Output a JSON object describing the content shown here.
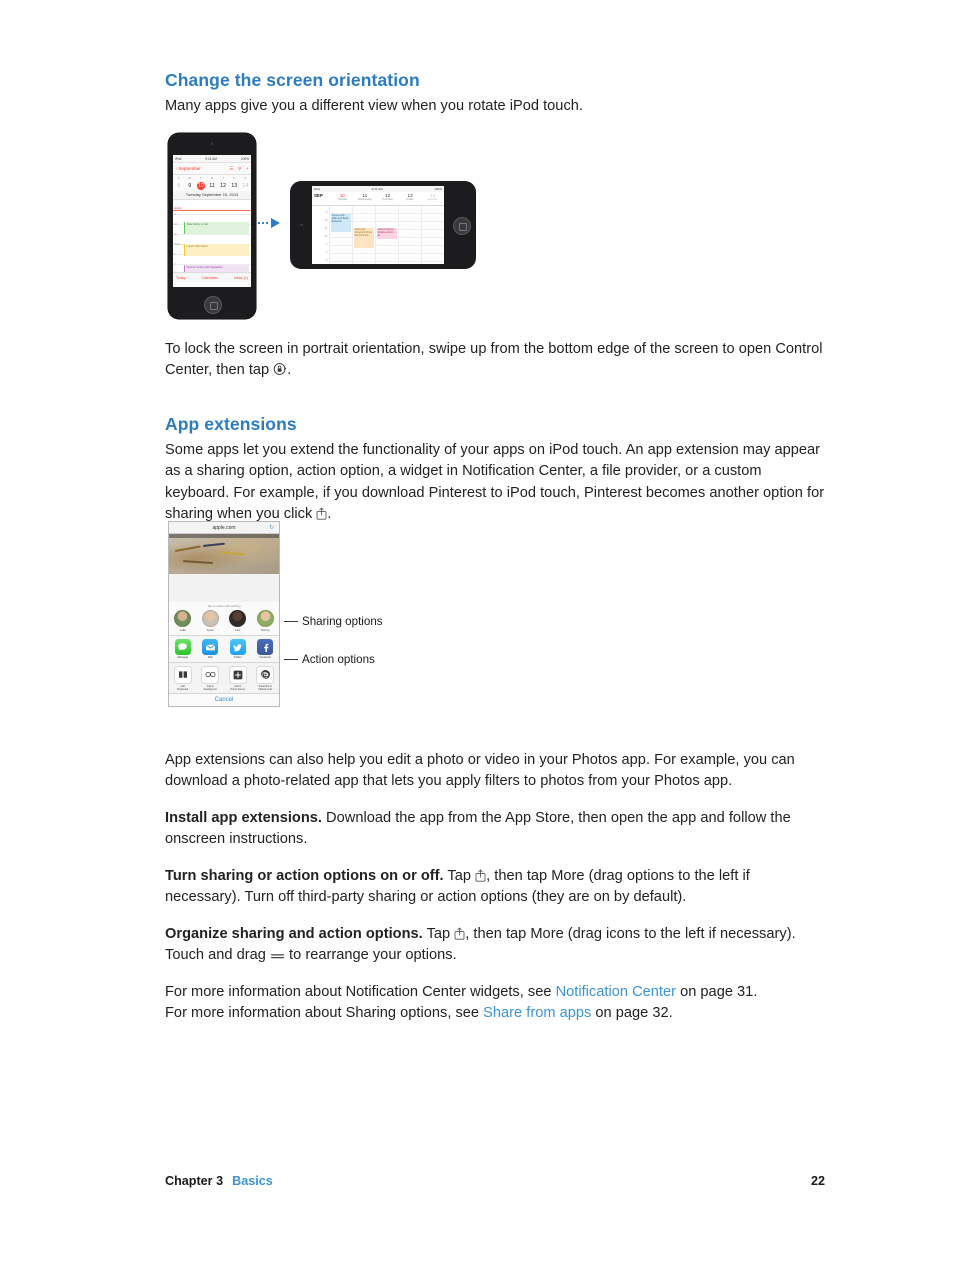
{
  "document": {
    "sections": [
      {
        "id": "change-orientation",
        "heading": "Change the screen orientation",
        "intro": "Many apps give you a different view when you rotate iPod touch.",
        "after_figure_line1": "To lock the screen in portrait orientation, swipe up from the bottom edge of the screen to open",
        "after_figure_line2_prefix": "Control Center, then tap ",
        "after_figure_line2_suffix": "."
      },
      {
        "id": "app-extensions",
        "heading": "App extensions",
        "paragraph1_part1": "Some apps let you extend the functionality of your apps on iPod touch. An app extension may appear as a sharing option, action option, a widget in Notification Center, a file provider, or a custom keyboard. For example, if you download Pinterest to iPod touch, Pinterest becomes another option for sharing when you click ",
        "paragraph1_part2": ".",
        "paragraph2": "App extensions can also help you edit a photo or video in your Photos app. For example, you can download a photo-related app that lets you apply filters to photos from your Photos app.",
        "install_bold": "Install app extensions.",
        "install_rest": " Download the app from the App Store, then open the app and follow the onscreen instructions.",
        "turn_bold": "Turn sharing or action options on or off.",
        "turn_rest_a": " Tap ",
        "turn_rest_b": ", then tap More (drag options to the left if necessary). Turn off third-party sharing or action options (they are on by default).",
        "organize_bold": "Organize sharing and action options.",
        "organize_rest_a": " Tap ",
        "organize_rest_b": ", then tap More (drag icons to the left if necessary). Touch and drag ",
        "organize_rest_c": " to rearrange your options.",
        "crossref1_pre": "For more information about Notification Center widgets, see ",
        "crossref1_link": "Notification Center",
        "crossref1_post": " on page 31.",
        "crossref2_pre": "For more information about Sharing options, see ",
        "crossref2_link": "Share from apps",
        "crossref2_post": " on page 32."
      }
    ]
  },
  "figure_devices": {
    "portrait": {
      "status_left": "iPod",
      "status_center": "9:41 AM",
      "status_right": "100%",
      "nav_back": "September",
      "day_initials": [
        "S",
        "M",
        "T",
        "W",
        "T",
        "F",
        "S"
      ],
      "dates": [
        "8",
        "9",
        "10",
        "11",
        "12",
        "13",
        "14"
      ],
      "today_index": 2,
      "date_title": "Tuesday September 10, 2013",
      "all_day_label": "all-day",
      "hour_labels": [
        "9",
        "10",
        "11",
        "Noon",
        "1",
        "2",
        "3"
      ],
      "events": [
        {
          "title": "Take Marty to Vet",
          "color": "green"
        },
        {
          "title": "Lunch with Dawn",
          "color": "yellow"
        },
        {
          "title": "Review Script with Sebastian",
          "color": "purple"
        }
      ],
      "toolbar": [
        "Today",
        "Calendars",
        "Inbox (1)"
      ]
    },
    "landscape": {
      "status_left": "iPod",
      "status_center": "9:41 AM",
      "status_right": "100%",
      "month_label": "SEP",
      "columns": [
        {
          "date": "10",
          "day": "Tuesday",
          "today": true
        },
        {
          "date": "11",
          "day": "Wednesday",
          "today": false
        },
        {
          "date": "12",
          "day": "Thursday",
          "today": false
        },
        {
          "date": "13",
          "day": "Friday",
          "today": false
        },
        {
          "date": "14",
          "day": "Saturday",
          "today": false
        }
      ],
      "hour_labels": [
        "9",
        "10",
        "11",
        "12",
        "1",
        "2",
        "3"
      ],
      "events": [
        {
          "title": "Cheese with Jillian Left Bank Brasserie",
          "color": "blue"
        },
        {
          "title": "Infant edit Rosewind Drone and Cinemas",
          "color": "orange"
        },
        {
          "title": "Closed Canyon Melissa arrives at...",
          "color": "pink"
        }
      ]
    }
  },
  "figure_share": {
    "address_bar": "apple.com",
    "refresh_icon": "refresh-icon",
    "airdrop_hint": "Tap to share with AirDrop",
    "people": [
      {
        "name": "Luke",
        "color": "#8f7a63"
      },
      {
        "name": "Tyson",
        "color": "#b99e84"
      },
      {
        "name": "Lexi",
        "color": "#6c5545"
      },
      {
        "name": "Tammy",
        "color": "#9ab06a"
      }
    ],
    "share_apps": [
      {
        "name": "Message",
        "icon": "message-icon",
        "glyph": "●"
      },
      {
        "name": "Mail",
        "icon": "mail-icon",
        "glyph": "✉"
      },
      {
        "name": "Twitter",
        "icon": "twitter-icon",
        "glyph": "ᵛ"
      },
      {
        "name": "Facebook",
        "icon": "facebook-icon",
        "glyph": "f"
      }
    ],
    "action_items": [
      {
        "name": "Add\nBookmark",
        "label_line1": "Add",
        "label_line2": "Bookmark",
        "icon": "book-icon"
      },
      {
        "name": "Add to Reading List",
        "label_line1": "Add to",
        "label_line2": "Reading List",
        "icon": "glasses-icon"
      },
      {
        "name": "Add to Home Screen",
        "label_line1": "Add to",
        "label_line2": "Home Screen",
        "icon": "plus-icon"
      },
      {
        "name": "Subscribe in Shared Links",
        "label_line1": "Subscribe in",
        "label_line2": "Shared Links",
        "icon": "at-icon"
      }
    ],
    "cancel": "Cancel",
    "callouts": [
      {
        "label": "Sharing options"
      },
      {
        "label": "Action options"
      }
    ]
  },
  "footer": {
    "chapter": "Chapter  3",
    "chapter_link": "Basics",
    "page_number": "22"
  },
  "colors": {
    "heading_blue": "#2b7cc0",
    "link_blue": "#3b93d8",
    "body_text": "#222222",
    "arrow_blue": "#2b7cc0"
  }
}
